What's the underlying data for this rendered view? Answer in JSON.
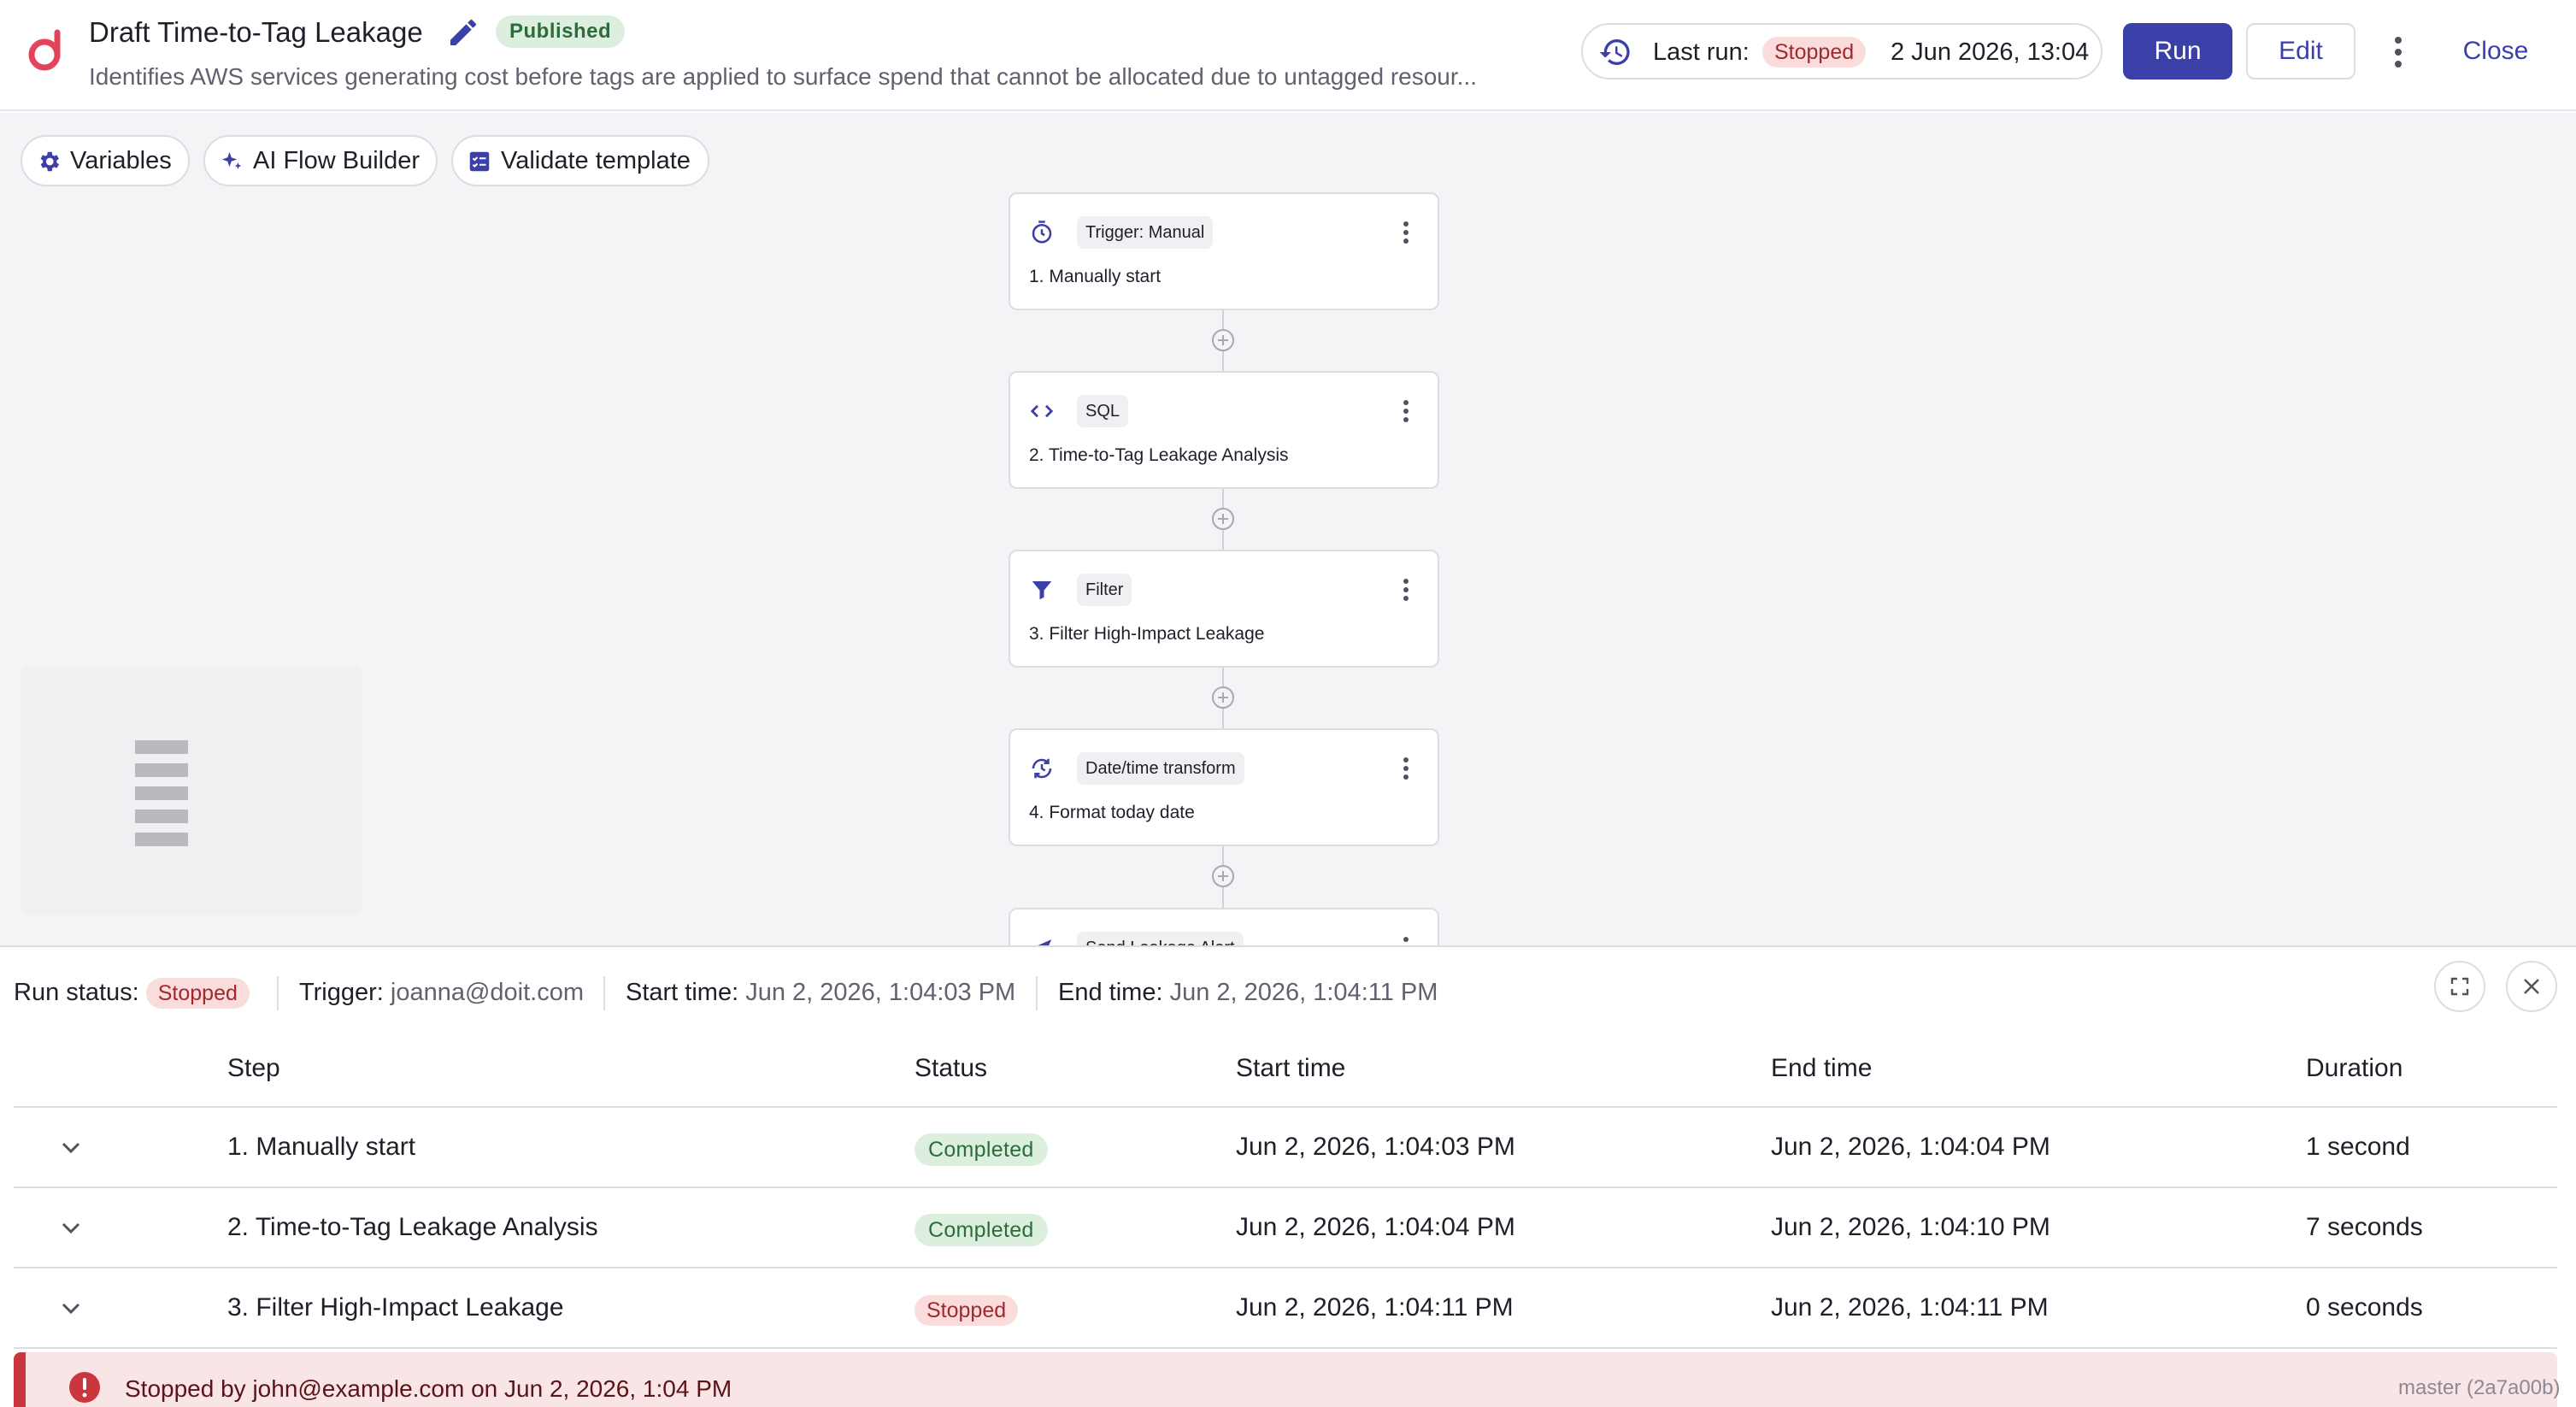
{
  "header": {
    "title": "Draft Time-to-Tag Leakage",
    "status_badge": "Published",
    "description": "Identifies AWS services generating cost before tags are applied to surface spend that cannot be allocated due to untagged resour...",
    "last_run_label": "Last run:",
    "last_run_status": "Stopped",
    "last_run_date": "2 Jun 2026, 13:04",
    "run_label": "Run",
    "edit_label": "Edit",
    "close_label": "Close"
  },
  "toolbar": {
    "variables": "Variables",
    "ai_flow_builder": "AI Flow Builder",
    "validate_template": "Validate template"
  },
  "nodes": [
    {
      "type": "Trigger: Manual",
      "name": "1. Manually start",
      "icon": "timer-icon"
    },
    {
      "type": "SQL",
      "name": "2. Time-to-Tag Leakage Analysis",
      "icon": "code-icon"
    },
    {
      "type": "Filter",
      "name": "3. Filter High-Impact Leakage",
      "icon": "filter-icon"
    },
    {
      "type": "Date/time transform",
      "name": "4. Format today date",
      "icon": "datetime-icon"
    },
    {
      "type": "Send Leakage Alert",
      "name": "",
      "icon": "send-icon"
    }
  ],
  "run": {
    "status_label": "Run status:",
    "status": "Stopped",
    "trigger_label": "Trigger:",
    "trigger": "joanna@doit.com",
    "start_label": "Start time:",
    "start": "Jun 2, 2026, 1:04:03 PM",
    "end_label": "End time:",
    "end": "Jun 2, 2026, 1:04:11 PM"
  },
  "table": {
    "headers": [
      "Step",
      "Status",
      "Start time",
      "End time",
      "Duration"
    ],
    "rows": [
      {
        "step": "1. Manually start",
        "status": "Completed",
        "start": "Jun 2, 2026, 1:04:03 PM",
        "end": "Jun 2, 2026, 1:04:04 PM",
        "duration": "1 second"
      },
      {
        "step": "2. Time-to-Tag Leakage Analysis",
        "status": "Completed",
        "start": "Jun 2, 2026, 1:04:04 PM",
        "end": "Jun 2, 2026, 1:04:10 PM",
        "duration": "7 seconds"
      },
      {
        "step": "3. Filter High-Impact Leakage",
        "status": "Stopped",
        "start": "Jun 2, 2026, 1:04:11 PM",
        "end": "Jun 2, 2026, 1:04:11 PM",
        "duration": "0 seconds"
      }
    ]
  },
  "alert": {
    "text": "Stopped by john@example.com on Jun 2, 2026, 1:04 PM"
  },
  "version": "master (2a7a00b)",
  "colors": {
    "accent": "#3b3fa8",
    "success_bg": "#dcefdf",
    "success_text": "#2c6c3c",
    "danger_bg": "#fadcdc",
    "danger_text": "#a3282d",
    "danger_accent": "#c9363d"
  }
}
